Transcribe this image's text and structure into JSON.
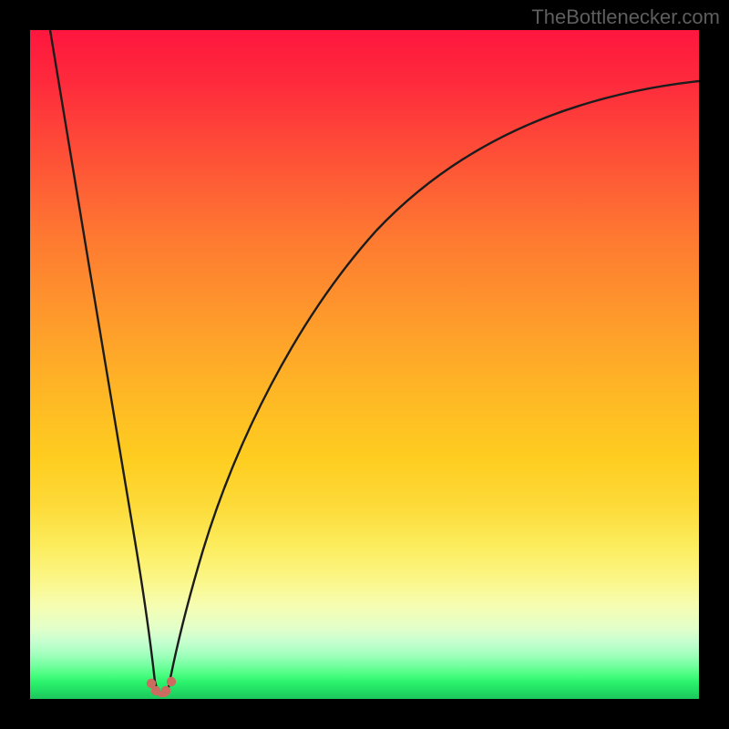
{
  "attribution": "TheBottlenecker.com",
  "colors": {
    "frame": "#000000",
    "gradient_top": "#fe163e",
    "gradient_mid": "#fecd20",
    "gradient_bottom": "#1cc75d",
    "curve_stroke": "#1c1c1c",
    "marker_fill": "#cc6b5f",
    "attribution_text": "#5e5e5e"
  },
  "chart_data": {
    "type": "line",
    "title": "",
    "xlabel": "",
    "ylabel": "",
    "xlim": [
      0,
      100
    ],
    "ylim": [
      0,
      100
    ],
    "series": [
      {
        "name": "left-curve",
        "x": [
          3.0,
          5.0,
          7.5,
          10.0,
          12.5,
          15.0,
          16.5,
          17.5,
          18.3
        ],
        "values": [
          100,
          84,
          64,
          45,
          27,
          12,
          5,
          2,
          0.5
        ]
      },
      {
        "name": "right-curve",
        "x": [
          20.5,
          21.5,
          23.0,
          25.0,
          28.0,
          32.0,
          37.0,
          44.0,
          52.0,
          62.0,
          74.0,
          88.0,
          100.0
        ],
        "values": [
          0.5,
          3,
          9,
          18,
          30,
          43,
          54,
          64,
          72,
          79,
          84.5,
          89,
          92
        ]
      }
    ],
    "markers": {
      "name": "cusp-markers",
      "x": [
        17.9,
        18.6,
        20.0,
        20.9
      ],
      "values": [
        1.2,
        0.5,
        0.5,
        1.5
      ]
    },
    "gradient_bands_y": [
      100,
      13,
      3,
      0
    ],
    "gradient_band_labels": [
      "red-orange",
      "yellow",
      "green"
    ]
  }
}
